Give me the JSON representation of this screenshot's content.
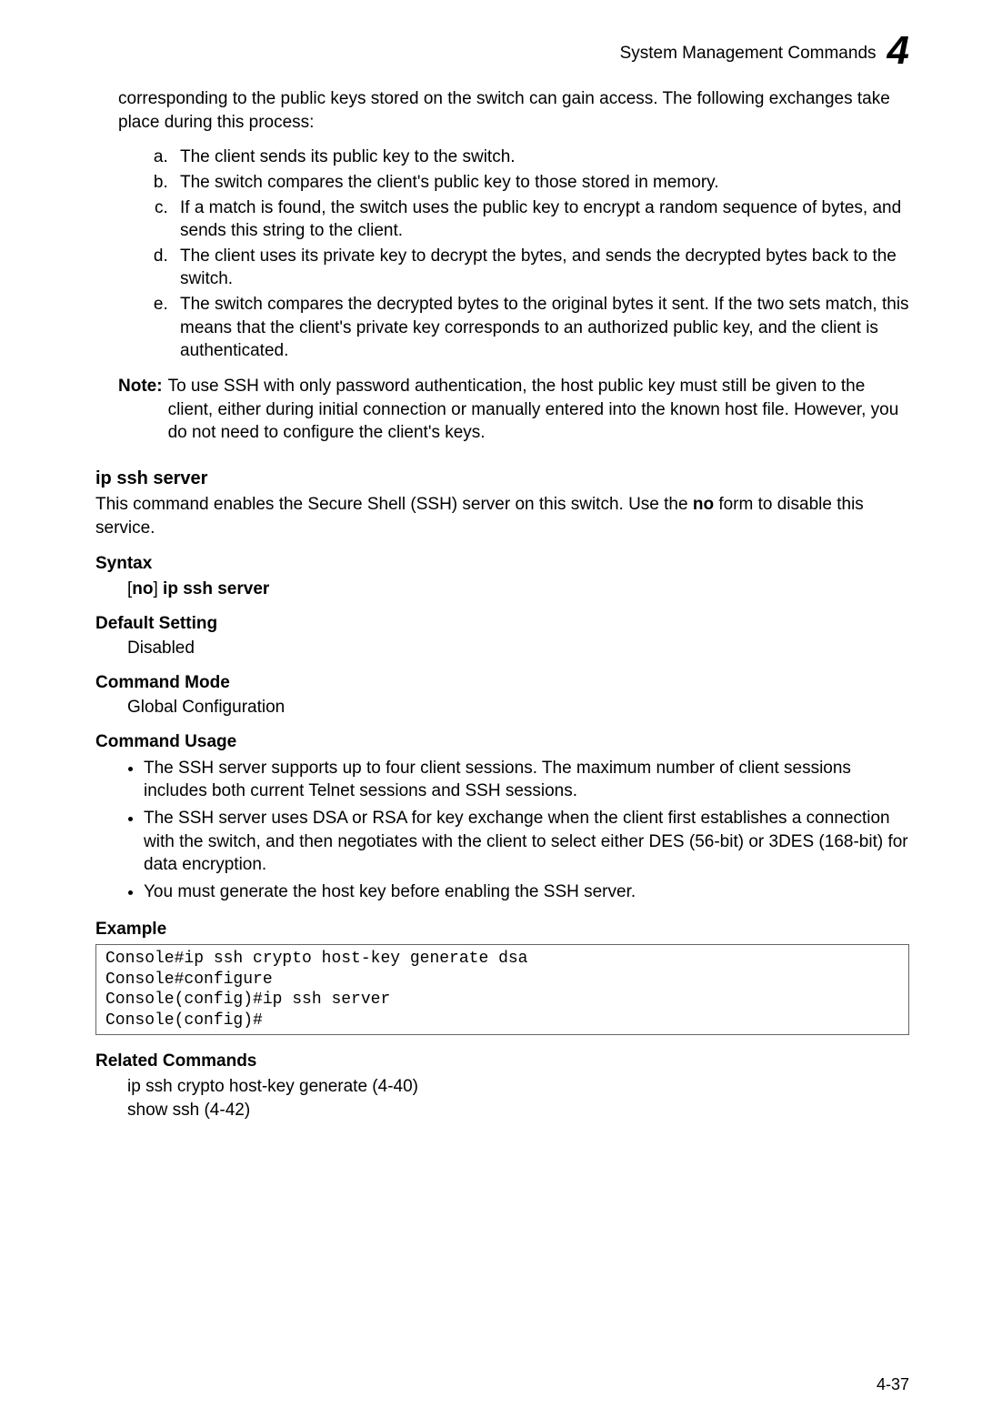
{
  "header": {
    "section_title": "System Management Commands",
    "chapter_number": "4"
  },
  "intro": "corresponding to the public keys stored on the switch can gain access. The following exchanges take place during this process:",
  "steps": [
    "The client sends its public key to the switch.",
    "The switch compares the client's public key to those stored in memory.",
    "If a match is found, the switch uses the public key to encrypt a random sequence of bytes, and sends this string to the client.",
    "The client uses its private key to decrypt the bytes, and sends the decrypted bytes back to the switch.",
    "The switch compares the decrypted bytes to the original bytes it sent. If the two sets match, this means that the client's private key corresponds to an authorized public key, and the client is authenticated."
  ],
  "note": {
    "label": "Note:",
    "text": "To use SSH with only password authentication, the host public key must still be given to the client, either during initial connection or manually entered into the known host file. However, you do not need to configure the client's keys."
  },
  "command": {
    "name": "ip ssh server",
    "desc_before": "This command enables the Secure Shell (SSH) server on this switch. Use the ",
    "desc_bold": "no",
    "desc_after": " form to disable this service.",
    "syntax_heading": "Syntax",
    "syntax_open": "[",
    "syntax_no": "no",
    "syntax_close": "]",
    "syntax_cmd": " ip ssh server",
    "default_heading": "Default Setting",
    "default_value": "Disabled",
    "mode_heading": "Command Mode",
    "mode_value": "Global Configuration",
    "usage_heading": "Command Usage",
    "usage_bullets": [
      "The SSH server supports up to four client sessions. The maximum number of client sessions includes both current Telnet sessions and SSH sessions.",
      "The SSH server uses DSA or RSA for key exchange when the client first establishes a connection with the switch, and then negotiates with the client to select either DES (56-bit) or 3DES (168-bit) for data encryption.",
      "You must generate the host key before enabling the SSH server."
    ],
    "example_heading": "Example",
    "example_code": "Console#ip ssh crypto host-key generate dsa\nConsole#configure\nConsole(config)#ip ssh server\nConsole(config)#",
    "related_heading": "Related Commands",
    "related": [
      "ip ssh crypto host-key generate (4-40)",
      "show ssh (4-42)"
    ]
  },
  "page_number": "4-37"
}
